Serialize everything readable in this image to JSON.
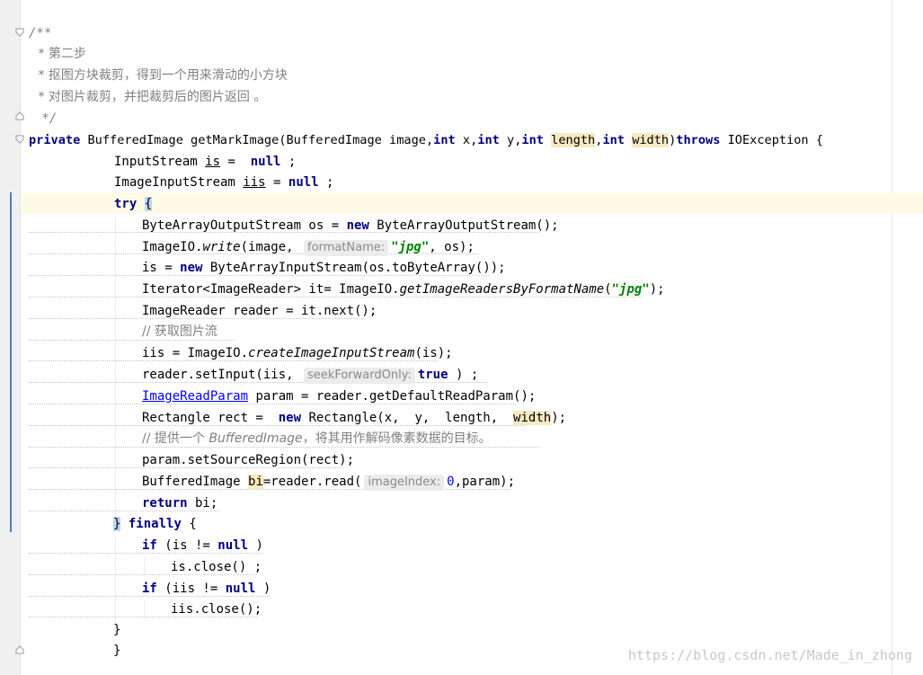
{
  "editor": {
    "lines": {
      "c0": "/**",
      "c1": " * 第二步",
      "c2": " * 抠图方块裁剪，得到一个用来滑动的小方块",
      "c3": " * 对图片裁剪，并把裁剪后的图片返回 。",
      "c4": " */",
      "sig_private": "private",
      "sig_type": " BufferedImage getMarkImage(BufferedImage image,",
      "sig_int1": "int",
      "sig_x": " x,",
      "sig_int2": "int",
      "sig_y": " y,",
      "sig_int3": "int",
      "sig_length": "length",
      "sig_comma": ",",
      "sig_int4": "int",
      "sig_width": "width",
      "sig_paren": ")",
      "sig_throws": "throws",
      "sig_tail": " IOException {",
      "l1_a": "InputStream ",
      "l1_var": "is",
      "l1_b": " =  ",
      "l1_null": "null",
      "l1_c": " ;",
      "l2_a": "ImageInputStream ",
      "l2_var": "iis",
      "l2_b": " = ",
      "l2_null": "null",
      "l2_c": " ;",
      "l3_try": "try",
      "l3_brace": "{",
      "l4_a": "ByteArrayOutputStream os = ",
      "l4_new": "new",
      "l4_b": " ByteArrayOutputStream();",
      "l5_a": "ImageIO.",
      "l5_write": "write",
      "l5_b": "(image, ",
      "l5_hint": "formatName:",
      "l5_str": "\"jpg\"",
      "l5_c": ", os);",
      "l6_a": "is = ",
      "l6_new": "new",
      "l6_b": " ByteArrayInputStream(os.toByteArray());",
      "l7_a": "Iterator<ImageReader> it= ImageIO.",
      "l7_m": "getImageReadersByFormatName",
      "l7_b": "(",
      "l7_str": "\"jpg\"",
      "l7_c": ");",
      "l8": "ImageReader reader = it.next();",
      "l9": "// 获取图片流",
      "l10_a": "iis = ImageIO.",
      "l10_m": "createImageInputStream",
      "l10_b": "(is);",
      "l11_a": "reader.setInput(iis, ",
      "l11_hint": "seekForwardOnly:",
      "l11_true": "true",
      "l11_b": " ) ;",
      "l12_link": "ImageReadParam",
      "l12_b": " param = reader.getDefaultReadParam();",
      "l13_a": "Rectangle rect =  ",
      "l13_new": "new",
      "l13_b": " Rectangle(x,  y,  length,  ",
      "l13_width": "width",
      "l13_c": ");",
      "l14_a": "// 提供一个 ",
      "l14_b": "BufferedImage",
      "l14_c": "，将其用作解码像素数据的目标。",
      "l15": "param.setSourceRegion(rect);",
      "l16_a": "BufferedImage ",
      "l16_var": "bi",
      "l16_b": "=reader.read(",
      "l16_hint": "imageIndex:",
      "l16_num": "0",
      "l16_c": ",param);",
      "l17_return": "return",
      "l17_b": " bi;",
      "l18_brace": "}",
      "l18_finally": "finally",
      "l18_b": " {",
      "l19_if": "if",
      "l19_a": " (is != ",
      "l19_null": "null",
      "l19_b": " )",
      "l20": "is.close() ;",
      "l21_if": "if",
      "l21_a": " (iis != ",
      "l21_null": "null",
      "l21_b": " )",
      "l22": "iis.close();",
      "l23": "}",
      "l24": "}"
    },
    "watermark": "https://blog.csdn.net/Made_in_zhong"
  },
  "colors": {
    "keyword": "#000080",
    "string": "#008000",
    "comment": "#808080",
    "number": "#0000ff",
    "highlight": "#f7eac2",
    "caret_row": "#fdfbe6",
    "brace_match": "#bcd6f5"
  }
}
